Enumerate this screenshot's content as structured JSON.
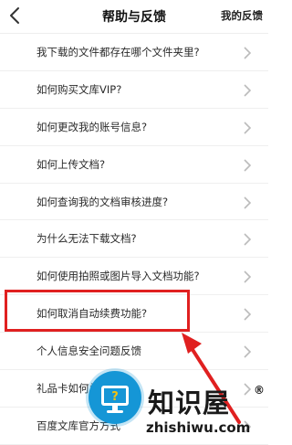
{
  "header": {
    "title": "帮助与反馈",
    "feedback_label": "我的反馈"
  },
  "faq": [
    {
      "label": "我下载的文件都存在哪个文件夹里?"
    },
    {
      "label": "如何购买文库VIP?"
    },
    {
      "label": "如何更改我的账号信息?"
    },
    {
      "label": "如何上传文档?"
    },
    {
      "label": "如何查询我的文档审核进度?"
    },
    {
      "label": "为什么无法下载文档?"
    },
    {
      "label": "如何使用拍照或图片导入文档功能?"
    },
    {
      "label": "如何取消自动续费功能?"
    },
    {
      "label": "个人信息安全问题反馈"
    },
    {
      "label": "礼品卡如何兑换?"
    },
    {
      "label": "百度文库官方方式"
    }
  ],
  "watermark": {
    "brand": "知识屋",
    "registered": "®",
    "url": "zhishiwu.com"
  },
  "colors": {
    "highlight": "#e02020",
    "watermark_blue": "#1596d6"
  }
}
